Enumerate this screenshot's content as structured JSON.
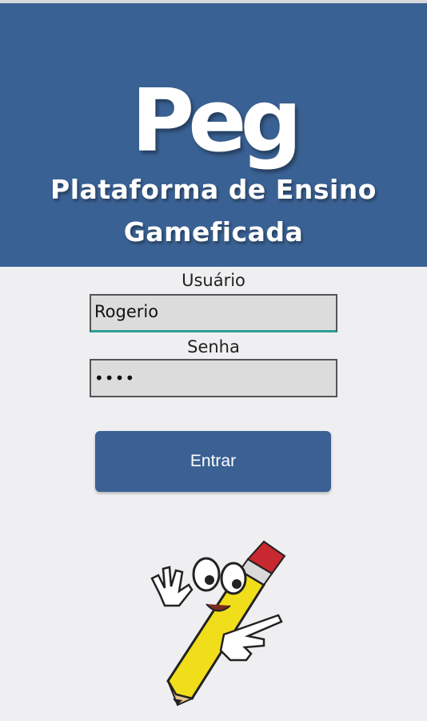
{
  "header": {
    "logo_text": "Peg",
    "tagline_line1": "Plataforma de Ensino",
    "tagline_line2": "Gameficada",
    "background": "#3a6193"
  },
  "login": {
    "username_label": "Usuário",
    "username_value": "Rogerio",
    "password_label": "Senha",
    "password_value": "••••",
    "submit_label": "Entrar"
  },
  "mascot": {
    "icon": "pencil-mascot-icon"
  }
}
